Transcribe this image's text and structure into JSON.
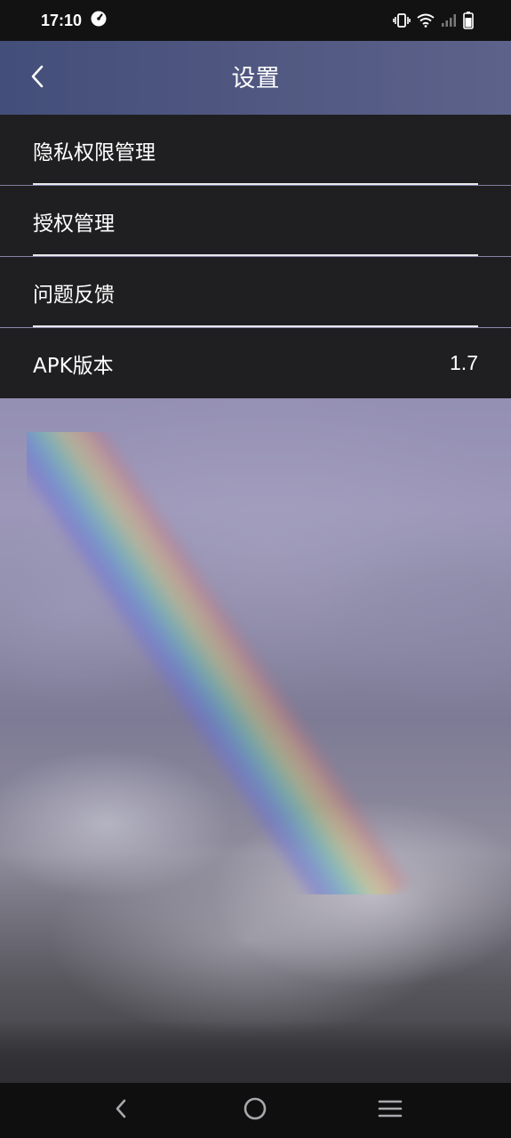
{
  "status_bar": {
    "time": "17:10",
    "icons": [
      "speedometer-icon",
      "vibrate-icon",
      "wifi-icon",
      "cellular-signal-icon",
      "battery-icon"
    ]
  },
  "header": {
    "title": "设置",
    "back_icon": "chevron-left-icon"
  },
  "settings": {
    "items": [
      {
        "label": "隐私权限管理",
        "value": ""
      },
      {
        "label": "授权管理",
        "value": ""
      },
      {
        "label": "问题反馈",
        "value": ""
      },
      {
        "label": "APK版本",
        "value": "1.7"
      }
    ]
  },
  "nav_bar": {
    "buttons": [
      "back-icon",
      "home-icon",
      "recents-menu-icon"
    ]
  },
  "colors": {
    "title_bar": "#4f5780",
    "list_background": "#1f1f21",
    "divider": "#e8e8ec",
    "status_bar": "#121212",
    "nav_bar": "#0f0f10"
  }
}
